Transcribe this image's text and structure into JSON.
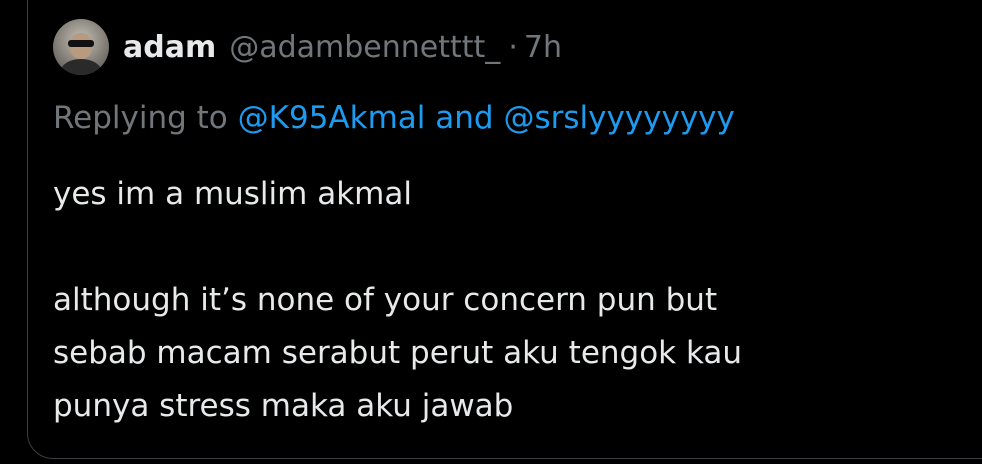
{
  "tweet": {
    "display_name": "adam",
    "handle": "@adambennetttt_",
    "separator": "·",
    "time": "7h",
    "reply": {
      "prefix": "Replying to",
      "user1": "@K95Akmal",
      "conjunction": "and",
      "user2": "@srslyyyyyyyy"
    },
    "text": {
      "line1": "yes im a muslim akmal",
      "line2": "although it’s none of your concern pun but",
      "line3": "sebab macam serabut perut aku tengok kau",
      "line4": "punya stress maka aku jawab"
    }
  },
  "colors": {
    "background": "#000000",
    "primary_text": "#e7e9ea",
    "secondary_text": "#71767b",
    "link": "#1d9bf0",
    "border": "#3a3d41"
  }
}
